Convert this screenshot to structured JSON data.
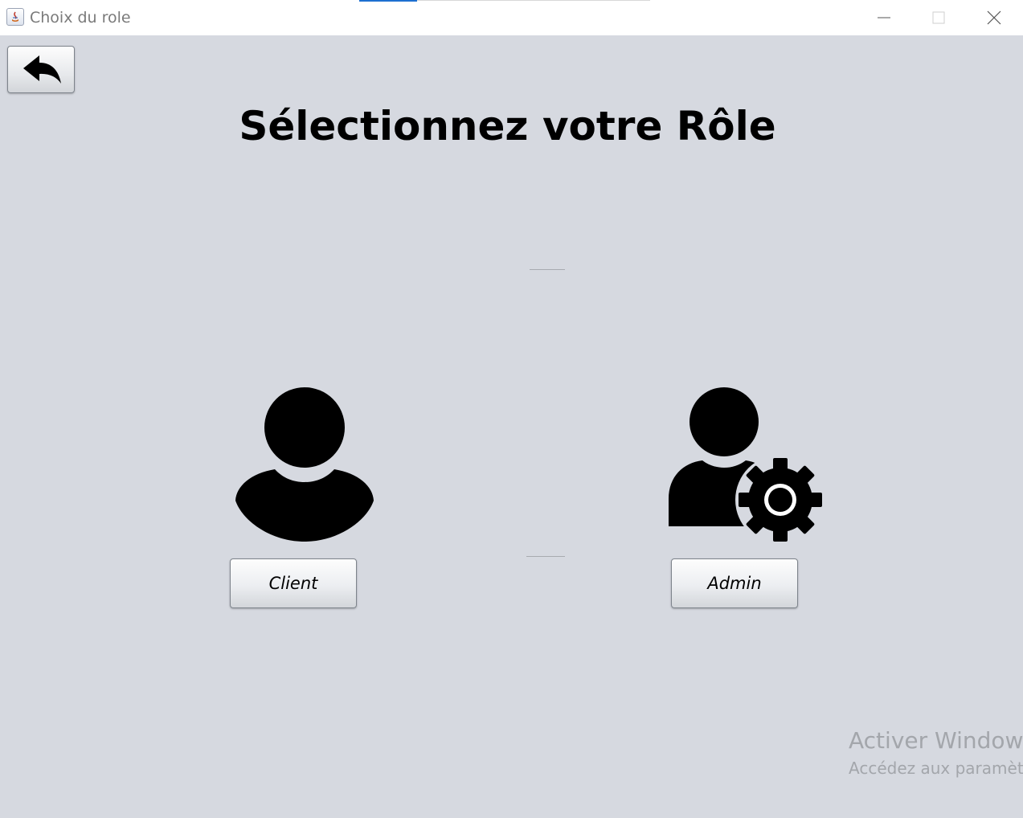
{
  "window": {
    "title": "Choix du role",
    "controls": {
      "minimize": "minimize-icon",
      "maximize": "maximize-icon",
      "close": "close-icon"
    }
  },
  "toolbar": {
    "back_icon": "back-arrow-icon"
  },
  "main": {
    "heading": "Sélectionnez votre Rôle",
    "roles": [
      {
        "label": "Client",
        "icon": "user-icon"
      },
      {
        "label": "Admin",
        "icon": "user-gear-icon"
      }
    ]
  },
  "watermark": {
    "title": "Activer Windows",
    "subtitle": "Accédez aux paramètres"
  },
  "colors": {
    "background": "#d6d9e0",
    "titlebar": "#ffffff",
    "text": "#000000",
    "accent": "#1e6fd0"
  }
}
